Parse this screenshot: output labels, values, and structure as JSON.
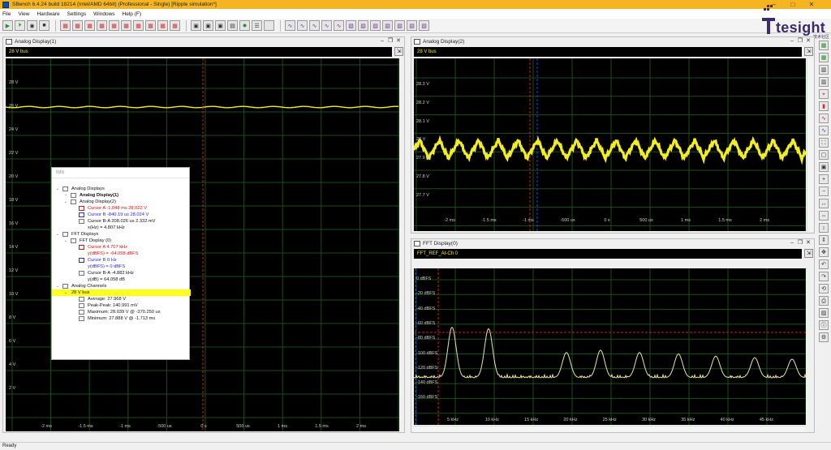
{
  "window": {
    "title": "SBench 6.4.24 build 18214 (Intel/AMD 64bit) (Professional - Single)   [Ripple simulation*]",
    "controls": [
      "–",
      "□",
      "✕"
    ]
  },
  "menu": [
    "File",
    "View",
    "Hardware",
    "Settings",
    "Windows",
    "Help (F)"
  ],
  "logo": {
    "word": "tesight",
    "sub": "技术社区",
    "color": "#3a2a72"
  },
  "panels": {
    "analog1": {
      "title": "Analog Display(1)",
      "channel": "28 V bus",
      "y_labels": [
        "28 V",
        "26 V",
        "24 V",
        "22 V",
        "20 V",
        "18 V",
        "16 V",
        "14 V",
        "12 V",
        "10 V",
        "8 V",
        "6 V",
        "4 V",
        "2 V"
      ],
      "x_labels": [
        "-2 ms",
        "-1.5 ms",
        "-1 ms",
        "-500 us",
        "0 s",
        "500 us",
        "1 ms",
        "1.5 ms",
        "2 ms"
      ]
    },
    "analog2": {
      "title": "Analog Display(2)",
      "channel": "28 V bus",
      "y_labels": [
        "28.3 V",
        "28.2 V",
        "28.1 V",
        "28 V",
        "27.9 V",
        "27.8 V",
        "27.7 V"
      ],
      "x_labels": [
        "-2 ms",
        "-1.5 ms",
        "-1 ms",
        "-500 us",
        "0 s",
        "500 us",
        "1 ms",
        "1.5 ms",
        "2 ms"
      ]
    },
    "fft": {
      "title": "FFT Display(0)",
      "channel": "FFT_REF_AI-Ch 0",
      "y_labels": [
        "0 dBFS",
        "-20 dBFS",
        "-40 dBFS",
        "-60 dBFS",
        "-80 dBFS",
        "-100 dBFS",
        "-120 dBFS",
        "-140 dBFS",
        "-160 dBFS"
      ],
      "x_labels": [
        "5 kHz",
        "10 kHz",
        "15 kHz",
        "20 kHz",
        "25 kHz",
        "30 kHz",
        "35 kHz",
        "40 kHz",
        "45 kHz"
      ]
    }
  },
  "info": {
    "header": "Info",
    "analog_displays": "Analog Displays",
    "ad1": "Analog Display(1)",
    "ad2": "Analog Display(2)",
    "cursor_a": "Cursor A  -1.048 ms  28.022 V",
    "cursor_b": "Cursor B  -840.19 us  28.024 V",
    "cursor_ba": "Cursor B-A  208.026 us  2.332 mV",
    "cursor_ba_freq": "x(Hz) = 4.807 kHz",
    "fft_displays": "FFT Displays",
    "fft_display": "FFT Display (0)",
    "fft_cursor_a": "Cursor A  4.707 kHz",
    "fft_cursor_a_y": "y(dBFS) = -64.058 dBFS",
    "fft_cursor_b": "Cursor B  0 Hz",
    "fft_cursor_b_y": "y(dBFS) = 0 dBFS",
    "fft_cursor_ba": "Cursor B-A  -4.882 kHz",
    "fft_cursor_ba_y": "y(dB) = 64.058 dB",
    "analog_channels": "Analog Channels",
    "channel": "28 V bus",
    "average": "Average:  27.968 V",
    "peak_peak": "Peak-Peak:  140.991 mV",
    "maximum": "Maximum:  28.039 V @  -370.250 us",
    "minimum": "Minimum:  27.888 V @  -1.713 ms"
  },
  "status": "Ready",
  "colors": {
    "trace": "#f2ee21",
    "grid": "#1d4d1d",
    "cursor_red": "#d02020",
    "cursor_blue": "#2244ee"
  }
}
